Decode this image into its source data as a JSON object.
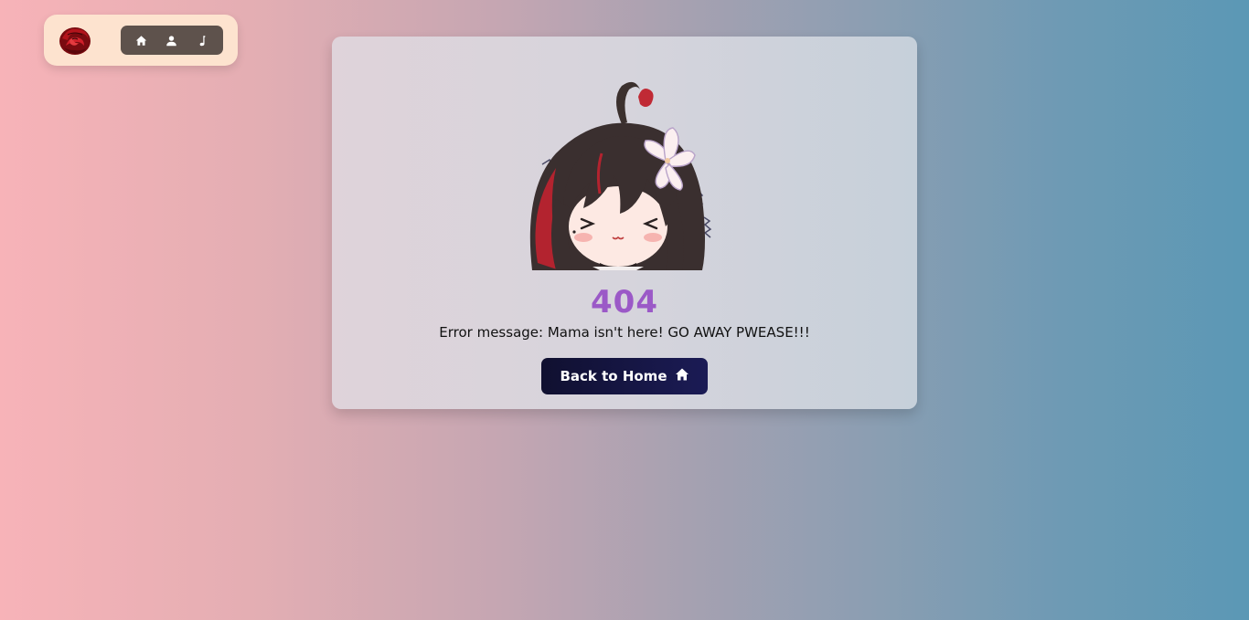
{
  "nav": {
    "logo_icon": "rose-logo-icon",
    "items": [
      {
        "icon": "home-icon"
      },
      {
        "icon": "user-icon"
      },
      {
        "icon": "music-note-icon"
      }
    ]
  },
  "error": {
    "code": "404",
    "message": "Error message: Mama isn't here! GO AWAY PWEASE!!!",
    "button_label": "Back to Home",
    "button_icon": "home-icon"
  },
  "colors": {
    "accent_code": "#9b59c7",
    "button_bg": "#141440",
    "nav_bg": "#fde3cf",
    "icon_bar_bg": "#5e524c"
  }
}
